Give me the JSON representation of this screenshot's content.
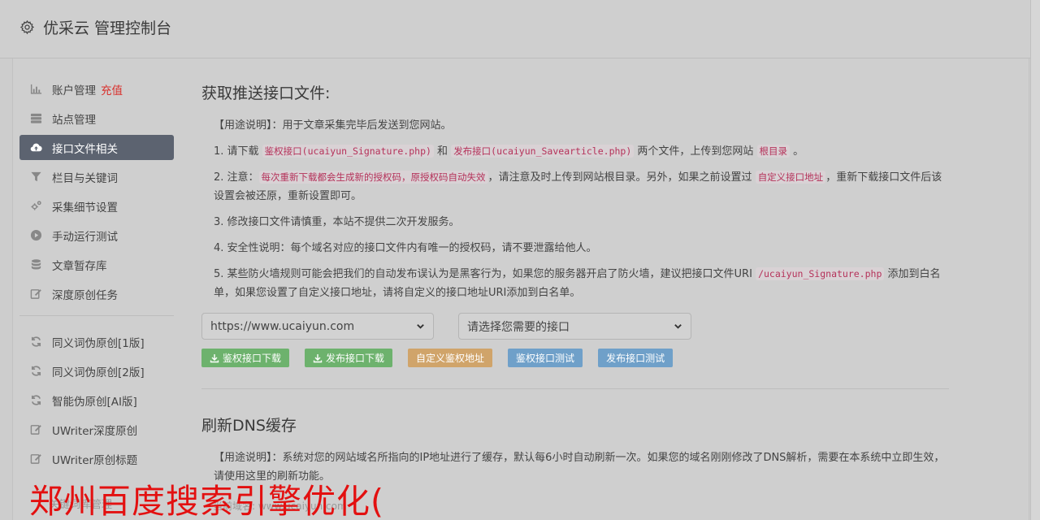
{
  "app": {
    "title": "优采云 管理控制台",
    "icon": "gear-icon"
  },
  "sidebar": {
    "items": [
      {
        "label": "账户管理",
        "badge": "充值",
        "icon": "bar-chart-icon"
      },
      {
        "label": "站点管理",
        "icon": "server-icon"
      },
      {
        "label": "接口文件相关",
        "icon": "cloud-upload-icon",
        "active": true
      },
      {
        "label": "栏目与关键词",
        "icon": "filter-icon"
      },
      {
        "label": "采集细节设置",
        "icon": "cogs-icon"
      },
      {
        "label": "手动运行测试",
        "icon": "play-circle-icon"
      },
      {
        "label": "文章暂存库",
        "icon": "database-icon"
      },
      {
        "label": "深度原创任务",
        "icon": "edit-icon"
      }
    ],
    "items2": [
      {
        "label": "同义词伪原创[1版]",
        "icon": "refresh-icon"
      },
      {
        "label": "同义词伪原创[2版]",
        "icon": "refresh-icon"
      },
      {
        "label": "智能伪原创[AI版]",
        "icon": "refresh-icon"
      },
      {
        "label": "UWriter深度原创",
        "icon": "edit-icon"
      },
      {
        "label": "UWriter原创标题",
        "icon": "edit-icon"
      }
    ]
  },
  "section1": {
    "title": "获取推送接口文件:",
    "usage": "【用途说明】：用于文章采集完毕后发送到您网站。",
    "step1": {
      "a": "1. 请下载 ",
      "code1": "鉴权接口(ucaiyun_Signature.php)",
      "b": " 和 ",
      "code2": "发布接口(ucaiyun_Savearticle.php)",
      "c": " 两个文件，上传到您网站 ",
      "code3": "根目录",
      "d": " 。"
    },
    "step2": {
      "a": "2. 注意：",
      "code1": "每次重新下载都会生成新的授权码，原授权码自动失效",
      "b": "，请注意及时上传到网站根目录。另外，如果之前设置过 ",
      "code2": "自定义接口地址",
      "c": "，重新下载接口文件后该设置会被还原，重新设置即可。"
    },
    "step3": "3. 修改接口文件请慎重，本站不提供二次开发服务。",
    "step4": "4. 安全性说明：每个域名对应的接口文件内有唯一的授权码，请不要泄露给他人。",
    "step5": {
      "a": "5. 某些防火墙规则可能会把我们的自动发布误认为是黑客行为，如果您的服务器开启了防火墙，建议把接口文件URI ",
      "code1": "/ucaiyun_Signature.php",
      "b": " 添加到白名单，如果您设置了自定义接口地址，请将自定义的接口地址URI添加到白名单。"
    },
    "site_select": "https://www.ucaiyun.com",
    "api_select": "请选择您需要的接口",
    "buttons": {
      "download_auth": "鉴权接口下载",
      "download_publish": "发布接口下载",
      "custom_auth": "自定义鉴权地址",
      "test_auth": "鉴权接口测试",
      "test_publish": "发布接口测试"
    },
    "colors": {
      "green": "#6db26d",
      "orange": "#d0a46a",
      "blue": "#6fa0c9"
    }
  },
  "section2": {
    "title": "刷新DNS缓存",
    "usage": "【用途说明】：系统对您的网站域名所指向的IP地址进行了缓存，默认每6小时自动刷新一次。如果您的域名刚刚修改了DNS解析，需要在本系统中立即生效，请使用这里的刷新功能。",
    "faint_domain": "当前域名: www.ucaiyun.com",
    "faint_left": "关键词库管理"
  },
  "watermark": "郑州百度搜索引擎优化("
}
